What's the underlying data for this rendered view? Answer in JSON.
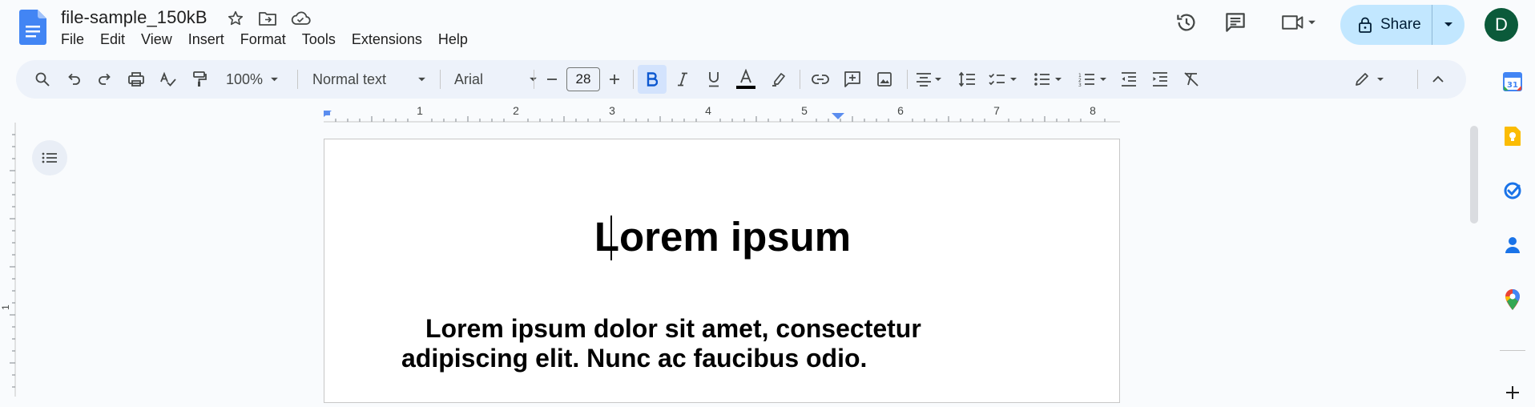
{
  "document": {
    "title": "file-sample_150kB",
    "heading": "Lorem ipsum",
    "paragraph": "Lorem ipsum dolor sit amet, consectetur adipiscing elit. Nunc ac faucibus odio."
  },
  "menu": [
    "File",
    "Edit",
    "View",
    "Insert",
    "Format",
    "Tools",
    "Extensions",
    "Help"
  ],
  "header": {
    "share_label": "Share",
    "avatar_initial": "D"
  },
  "toolbar": {
    "zoom": "100%",
    "style": "Normal text",
    "font": "Arial",
    "font_size": "28"
  },
  "ruler": {
    "numbers": [
      "1",
      "2",
      "3",
      "4",
      "5",
      "6",
      "7",
      "8"
    ],
    "left_number": "1"
  },
  "icons": {
    "header": [
      "docs-logo-icon",
      "star-icon",
      "move-folder-icon",
      "cloud-status-icon",
      "version-history-icon",
      "comments-icon",
      "meet-icon",
      "lock-icon"
    ],
    "side_panel": [
      "calendar-icon",
      "keep-icon",
      "tasks-icon",
      "contacts-icon",
      "maps-icon",
      "add-icon"
    ]
  },
  "colors": {
    "accent": "#1a73e8",
    "share_bg": "#c2e7ff",
    "toolbar_bg": "#edf2fa",
    "avatar_bg": "#0b5a3a"
  }
}
